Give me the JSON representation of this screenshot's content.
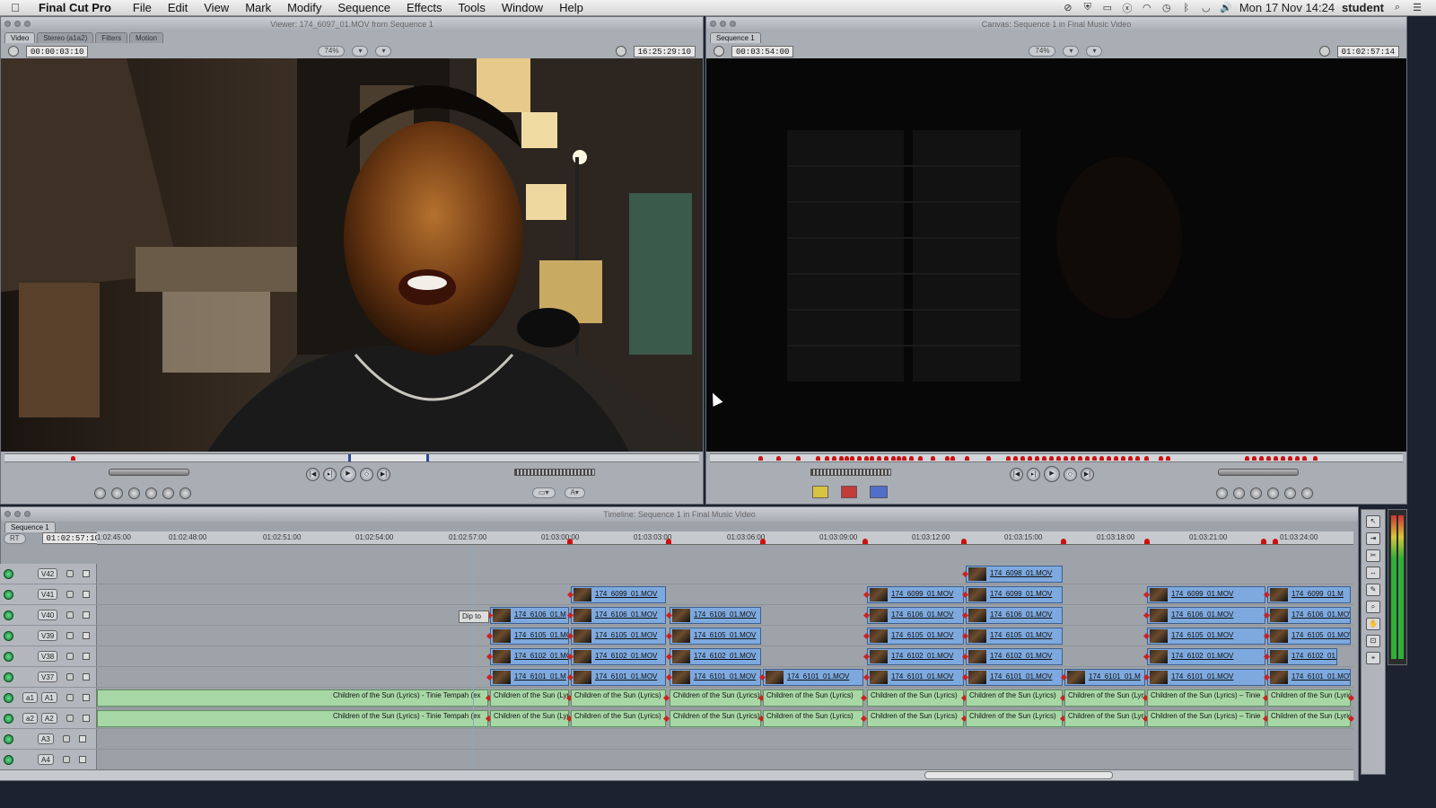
{
  "menubar": {
    "app_name": "Final Cut Pro",
    "menus": [
      "File",
      "Edit",
      "View",
      "Mark",
      "Modify",
      "Sequence",
      "Effects",
      "Tools",
      "Window",
      "Help"
    ],
    "clock": "Mon 17 Nov  14:24",
    "user": "student"
  },
  "viewer": {
    "title": "Viewer: 174_6097_01.MOV from Sequence 1",
    "tabs": [
      "Video",
      "Stereo (a1a2)",
      "Filters",
      "Motion"
    ],
    "duration_tc": "00:00:03:10",
    "zoom": "74%",
    "current_tc": "16:25:29:10"
  },
  "canvas": {
    "title": "Canvas: Sequence 1 in Final Music Video",
    "tab": "Sequence 1",
    "duration_tc": "00:03:54:00",
    "zoom": "74%",
    "current_tc": "01:02:57:14"
  },
  "timeline": {
    "title": "Timeline: Sequence 1 in Final Music Video",
    "tab": "Sequence 1",
    "rt_label": "RT",
    "current_tc": "01:02:57:10",
    "ruler_ticks": [
      "1:02:45:00",
      "01:02:48:00",
      "01:02:51:00",
      "01:02:54:00",
      "01:02:57:00",
      "01:03:00:00",
      "01:03:03:00",
      "01:03:06:00",
      "01:03:09:00",
      "01:03:12:00",
      "01:03:15:00",
      "01:03:18:00",
      "01:03:21:00",
      "01:03:24:00"
    ],
    "transition_label": "Dip to C",
    "video_tracks": [
      "V42",
      "V41",
      "V40",
      "V39",
      "V38",
      "V37"
    ],
    "audio_tracks": [
      {
        "src": "a1",
        "dst": "A1"
      },
      {
        "src": "a2",
        "dst": "A2"
      },
      {
        "src": "",
        "dst": "A3"
      },
      {
        "src": "",
        "dst": "A4"
      }
    ],
    "clip_names": {
      "c6098": "174_6098_01.MOV",
      "c6099": "174_6099_01.MOV",
      "c6106": "174_6106_01.MOV",
      "c6105": "174_6105_01.MOV",
      "c6102": "174_6102_01.MOV",
      "c6101": "174_6101_01.MOV",
      "c6099_cut": "174_6099_01.M",
      "c6106_cut": "174_6106_01.M",
      "c6102_cut": "174_6102_01.",
      "c6101_cut": "174_6101_01.M",
      "c6101_cut2": "174_6101_01.MOV"
    },
    "audio_clip": "Children of the Sun (Lyrics) - Tinie Tempah (ex",
    "audio_clip_cut": "Children of the Sun (Lyrics)",
    "audio_clip_mid": "Children of the Sun (Lyrics) – Tinie",
    "audio_clip_end": "Children of the Sun (Lyric"
  },
  "tools": [
    "selection-tool",
    "track-select-tool",
    "razor-tool",
    "slip-tool",
    "pen-tool",
    "zoom-tool",
    "hand-tool",
    "crop-tool",
    "distort-tool"
  ],
  "colors": {
    "video_clip": "#7ea9de",
    "audio_clip": "#a8d7a6",
    "marker": "#cc1111",
    "track_on": "#22aa55"
  }
}
